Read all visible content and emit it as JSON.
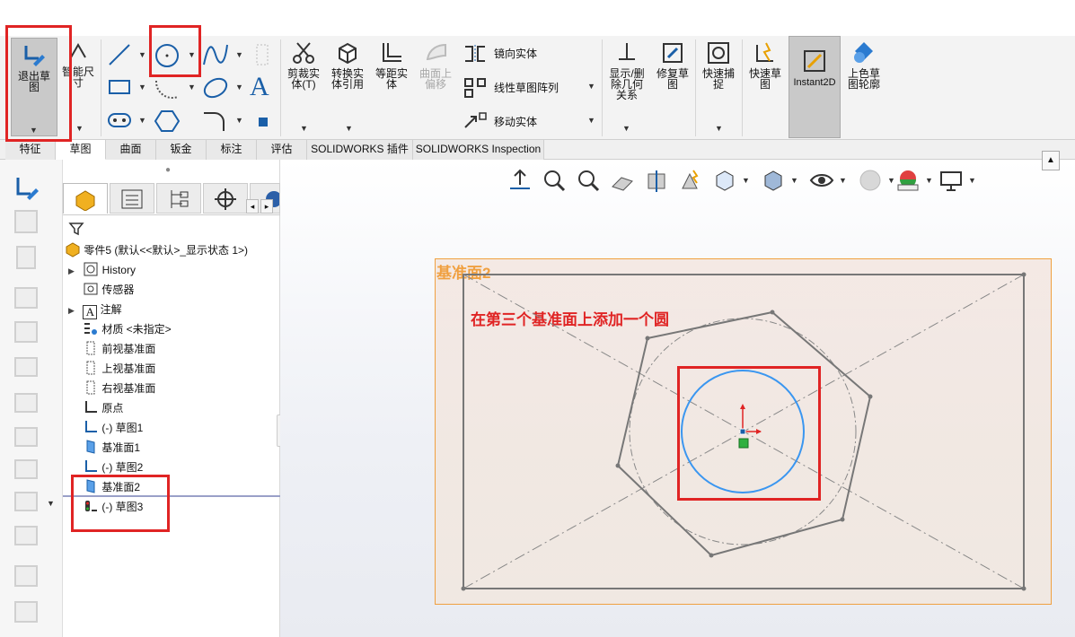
{
  "ribbon": {
    "exit_sketch": "退出草\n图",
    "smart_dimension": "智能尺\n寸",
    "trim": "剪裁实\n体(T)",
    "convert": "转换实\n体引用",
    "offset": "等距实\n体",
    "surface_offset": "曲面上\n偏移",
    "mirror": "镜向实体",
    "linear_pattern": "线性草图阵列",
    "move": "移动实体",
    "show_delete_relations": "显示/删\n除几何\n关系",
    "repair_sketch": "修复草\n图",
    "quick_snap": "快速捕\n捉",
    "rapid_sketch": "快速草\n图",
    "instant2d": "Instant2D",
    "shaded_contours": "上色草\n图轮廓"
  },
  "tabs": [
    "特征",
    "草图",
    "曲面",
    "钣金",
    "标注",
    "评估",
    "SOLIDWORKS 插件",
    "SOLIDWORKS Inspection"
  ],
  "tree": {
    "root": "零件5 (默认<<默认>_显示状态 1>)",
    "items": [
      "History",
      "传感器",
      "注解",
      "材质 <未指定>",
      "前视基准面",
      "上视基准面",
      "右视基准面",
      "原点",
      "(-) 草图1",
      "基准面1",
      "(-) 草图2",
      "基准面2",
      "(-) 草图3"
    ]
  },
  "viewport": {
    "plane_label": "基准面2",
    "annotation": "在第三个基准面上添加一个圆"
  },
  "colors": {
    "highlight": "#e02424",
    "plane_border": "#f0a040",
    "circle": "#3a96f0",
    "annotation": "#e02424"
  }
}
